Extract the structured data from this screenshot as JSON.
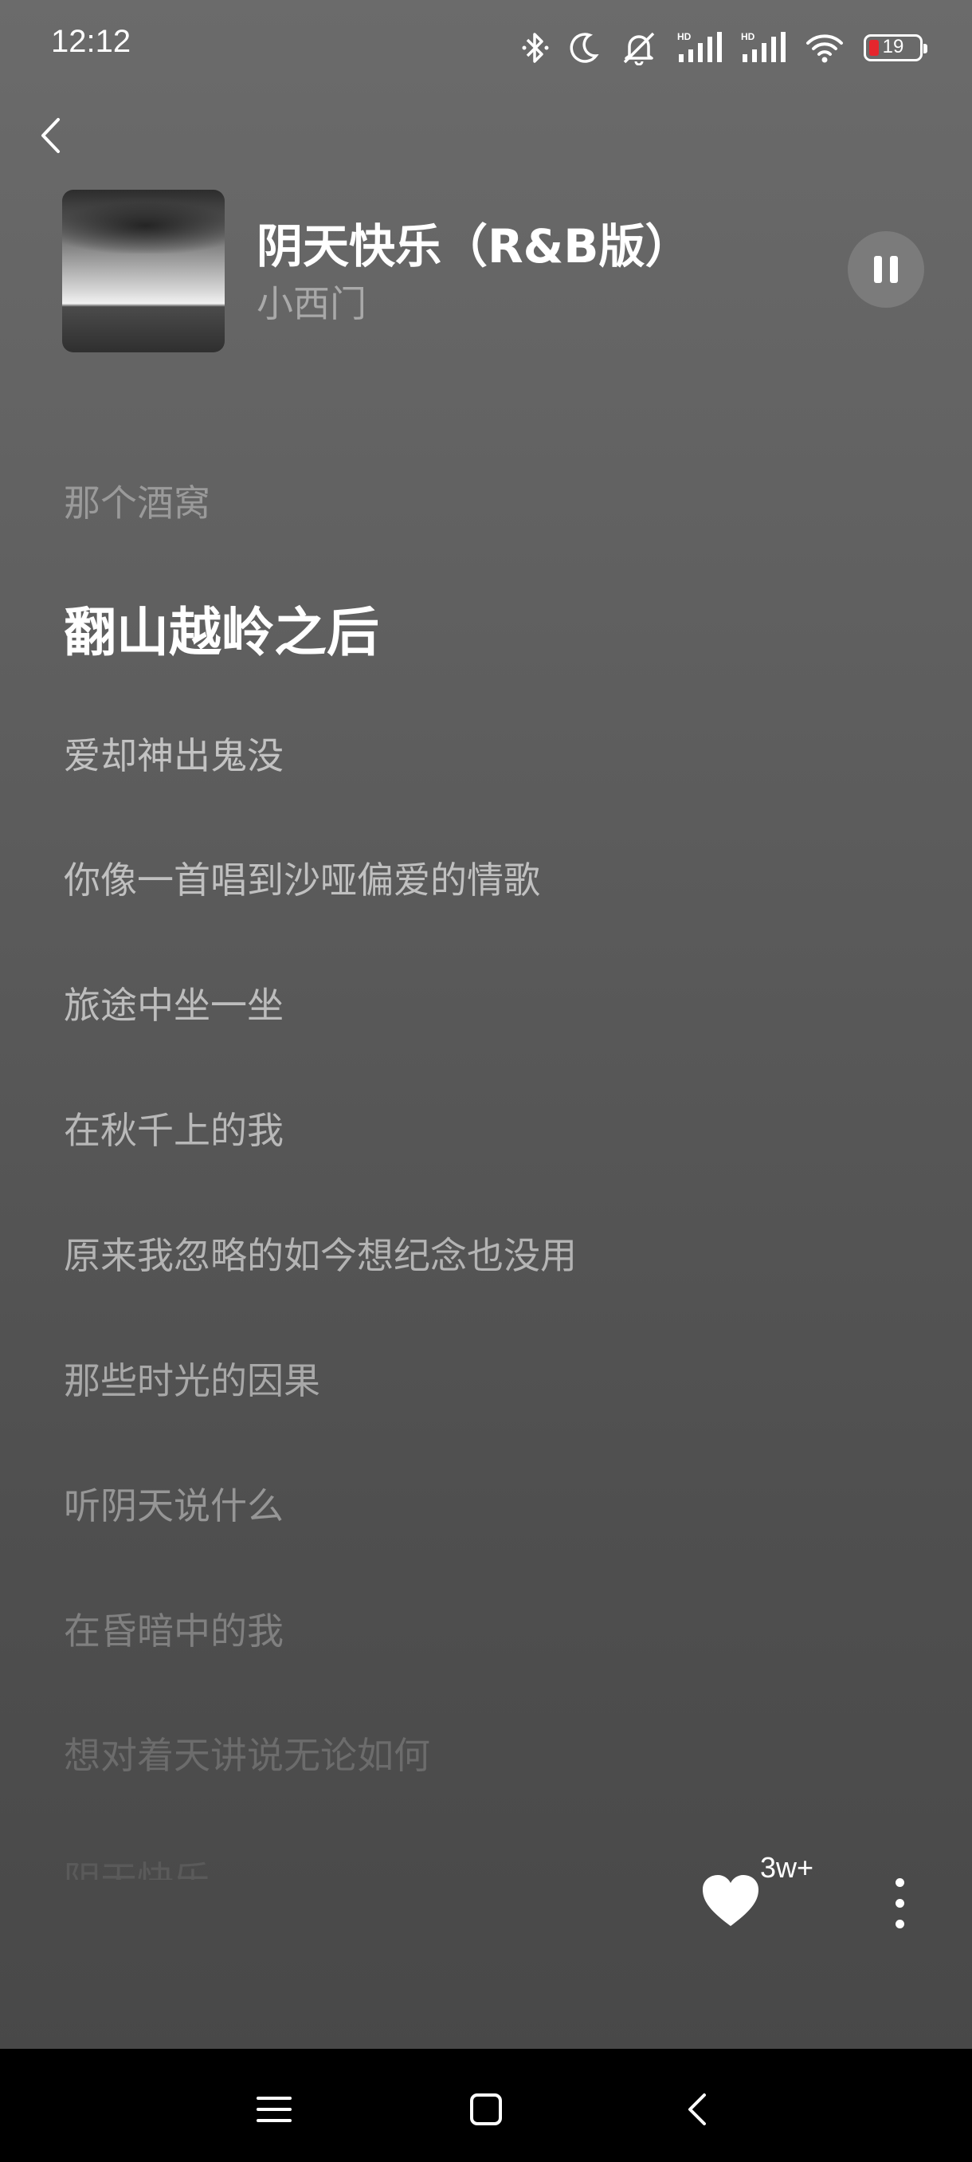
{
  "status_bar": {
    "time": "12:12",
    "icons": [
      "bluetooth-icon",
      "do-not-disturb-moon-icon",
      "mute-bell-icon",
      "hd-signal-icon",
      "hd-signal-icon",
      "wifi-icon",
      "battery-icon"
    ],
    "battery_level": "19",
    "battery_color": "#e5262d"
  },
  "header": {
    "back_icon": "chevron-left-icon",
    "song_title": "阴天快乐（R&B版）",
    "artist": "小西门",
    "pause_icon": "pause-icon"
  },
  "lyrics": [
    {
      "text": "那个酒窝",
      "state": "past"
    },
    {
      "text": "翻山越岭之后",
      "state": "current"
    },
    {
      "text": "爱却神出鬼没",
      "state": "upcoming"
    },
    {
      "text": "你像一首唱到沙哑偏爱的情歌",
      "state": "upcoming"
    },
    {
      "text": "旅途中坐一坐",
      "state": "upcoming"
    },
    {
      "text": "在秋千上的我",
      "state": "upcoming"
    },
    {
      "text": "原来我忽略的如今想纪念也没用",
      "state": "upcoming"
    },
    {
      "text": "那些时光的因果",
      "state": "upcoming"
    },
    {
      "text": "听阴天说什么",
      "state": "upcoming"
    },
    {
      "text": "在昏暗中的我",
      "state": "upcoming"
    },
    {
      "text": "想对着天讲说无论如何",
      "state": "upcoming"
    },
    {
      "text": "阴天快乐",
      "state": "upcoming"
    }
  ],
  "actions": {
    "like_icon": "heart-icon",
    "like_count": "3w+",
    "more_icon": "more-vertical-icon"
  },
  "nav_bar": {
    "icons": [
      "menu-icon",
      "home-square-icon",
      "back-chevron-icon"
    ]
  }
}
